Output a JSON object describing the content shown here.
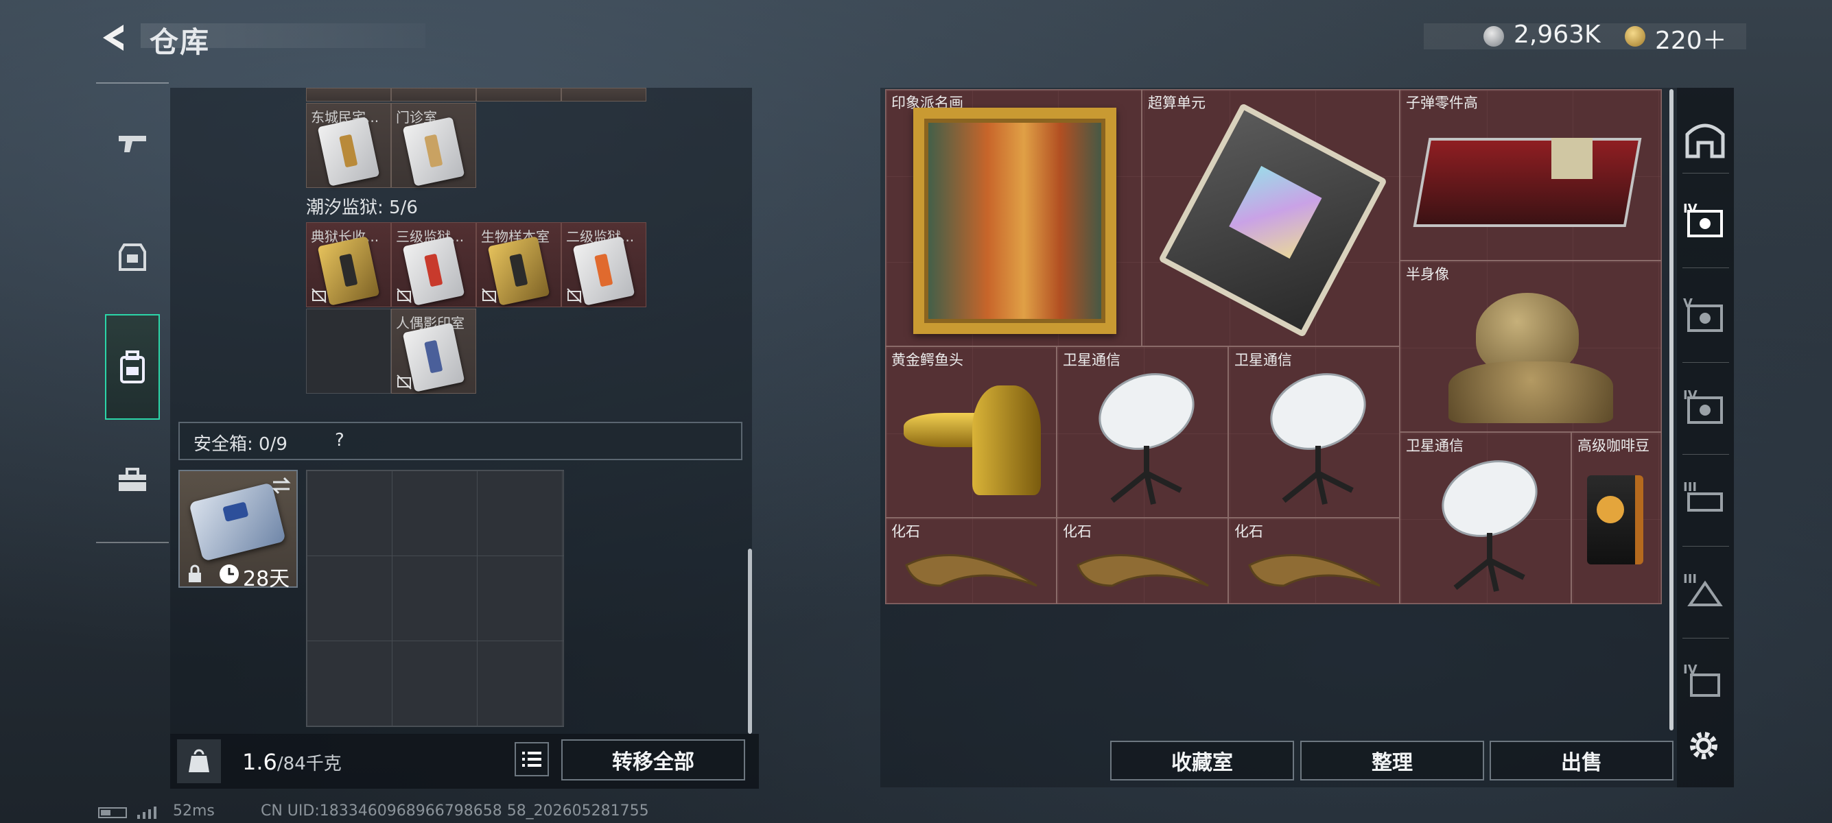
{
  "header": {
    "title": "仓库"
  },
  "currency": {
    "silver": "2,963K",
    "gold": "220＋"
  },
  "colors": {
    "accent": "#2bd6a8",
    "stash_bg": "#4b2a2e"
  },
  "left_tabs": [
    "gun-icon",
    "armor-icon",
    "backpack-icon",
    "case-icon"
  ],
  "keys_top": [
    {
      "label": "东城民宅..."
    },
    {
      "label": "门诊室"
    }
  ],
  "prison": {
    "title": "潮汐监狱: 5/6",
    "cards": [
      {
        "label": "典狱长收..."
      },
      {
        "label": "三级监狱..."
      },
      {
        "label": "生物样本室"
      },
      {
        "label": "二级监狱..."
      },
      {
        "label": "人偶影印室"
      }
    ]
  },
  "safe_box": {
    "title": "安全箱: 0/9",
    "help": "?",
    "timer": "28天"
  },
  "weight": {
    "current": "1.6",
    "max": "/84千克"
  },
  "buttons": {
    "transfer_all": "转移全部",
    "collection": "收藏室",
    "sort": "整理",
    "sell": "出售"
  },
  "stash_items": [
    {
      "label": "印象派名画"
    },
    {
      "label": "超算单元"
    },
    {
      "label": "子弹零件高"
    },
    {
      "label": "半身像"
    },
    {
      "label": "黄金鳄鱼头"
    },
    {
      "label": "卫星通信"
    },
    {
      "label": "卫星通信"
    },
    {
      "label": "卫星通信"
    },
    {
      "label": "高级咖啡豆"
    },
    {
      "label": "化石"
    },
    {
      "label": "化石"
    },
    {
      "label": "化石"
    }
  ],
  "sidebar_tiers": [
    "IV",
    "V",
    "IV",
    "III",
    "III",
    "IV"
  ],
  "footer": {
    "ping": "52ms",
    "uid": "CN UID:1833460968966798658 58_202605281755"
  }
}
